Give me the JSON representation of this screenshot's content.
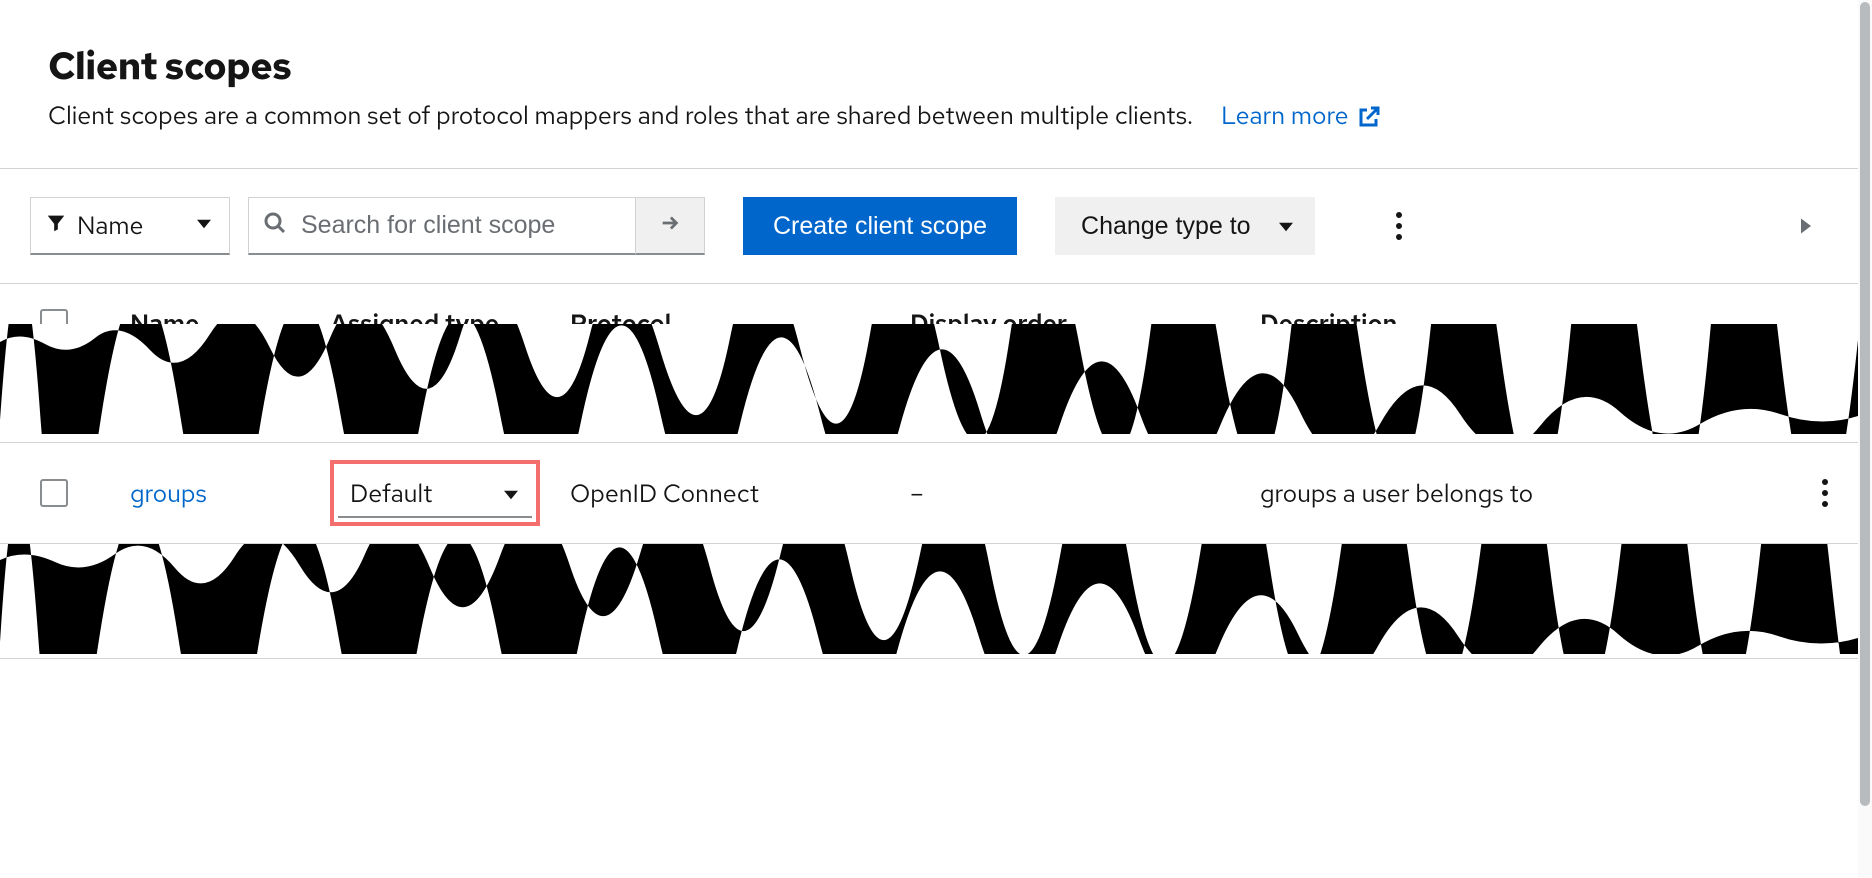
{
  "header": {
    "title": "Client scopes",
    "subtitle": "Client scopes are a common set of protocol mappers and roles that are shared between multiple clients.",
    "learn_more": "Learn more"
  },
  "toolbar": {
    "filter_label": "Name",
    "search_placeholder": "Search for client scope",
    "create_label": "Create client scope",
    "change_type_label": "Change type to"
  },
  "table": {
    "headers": {
      "name": "Name",
      "assigned_type": "Assigned type",
      "protocol": "Protocol",
      "display_order": "Display order",
      "description": "Description"
    },
    "row": {
      "name": "groups",
      "assigned_type": "Default",
      "protocol": "OpenID Connect",
      "display_order": "–",
      "description": "groups a user belongs to"
    }
  }
}
